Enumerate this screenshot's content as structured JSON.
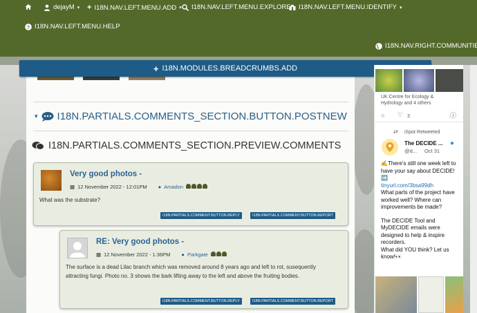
{
  "nav": {
    "user": "dejayM",
    "add": "I18N.NAV.LEFT.MENU.ADD",
    "explore": "I18N.NAV.LEFT.MENU.EXPLORE",
    "identify": "I18N.NAV.LEFT.MENU.IDENTIFY",
    "help": "I18N.NAV.LEFT.MENU.HELP",
    "communities": "I18N.NAV.RIGHT.COMMUNITIES"
  },
  "breadcrumbs": {
    "add_label": "I18N.MODULES.BREADCRUMBS.ADD"
  },
  "comments_section": {
    "postnew": "I18N.PARTIALS.COMMENTS_SECTION.BUTTON.POSTNEW",
    "preview_title": "I18N.PARTIALS.COMMENTS_SECTION.PREVIEW.COMMENTS"
  },
  "comments": [
    {
      "title": "Very good photos -",
      "date": "12 November 2022 - 12:01PM",
      "user": "Amadon",
      "body": "What was the substrate?",
      "reply": "I18N.PARTIALS.COMMENT.BUTTON.REPLY",
      "report": "I18N.PARTIALS.COMMENT.BUTTON.REPORT"
    },
    {
      "title": "RE: Very good photos -",
      "date": "12 November 2022 - 1:36PM",
      "user": "Parkgate",
      "body": "The surface is a dead Lilac branch which was removed around 8 years ago and left to rot, susequently attracting fungi. Photo no. 3 shows the bark lifting away to the left and above the fruiting bodies.",
      "reply": "I18N.PARTIALS.COMMENT.BUTTON.REPLY",
      "report": "I18N.PARTIALS.COMMENT.BUTTON.REPORT"
    }
  ],
  "sidebar": {
    "caption": "UK Centre for Ecology & Hydrology and 4 others",
    "like_count": "3",
    "retweet_label": "iSpot Retweeted",
    "tweet_author": "The DECIDE ...",
    "tweet_handle": "@d...",
    "tweet_date": "Oct 31",
    "tweet_line1": "✍️There's still one week left to have your say about DECIDE!➡️",
    "tweet_link": "tinyurl.com/3bsa99dh",
    "tweet_line2": "What parts of the project have worked well? Where can improvements be made?",
    "tweet_line3": "The DECIDE Tool and MyDECIDE emails were designed to help & inspire recorders.",
    "tweet_line4": "What did YOU think? Let us know!👀"
  },
  "colors": {
    "nav_bg": "#53692a",
    "accent_blue": "#1e5b86",
    "comment_bg": "#e9ede1"
  }
}
